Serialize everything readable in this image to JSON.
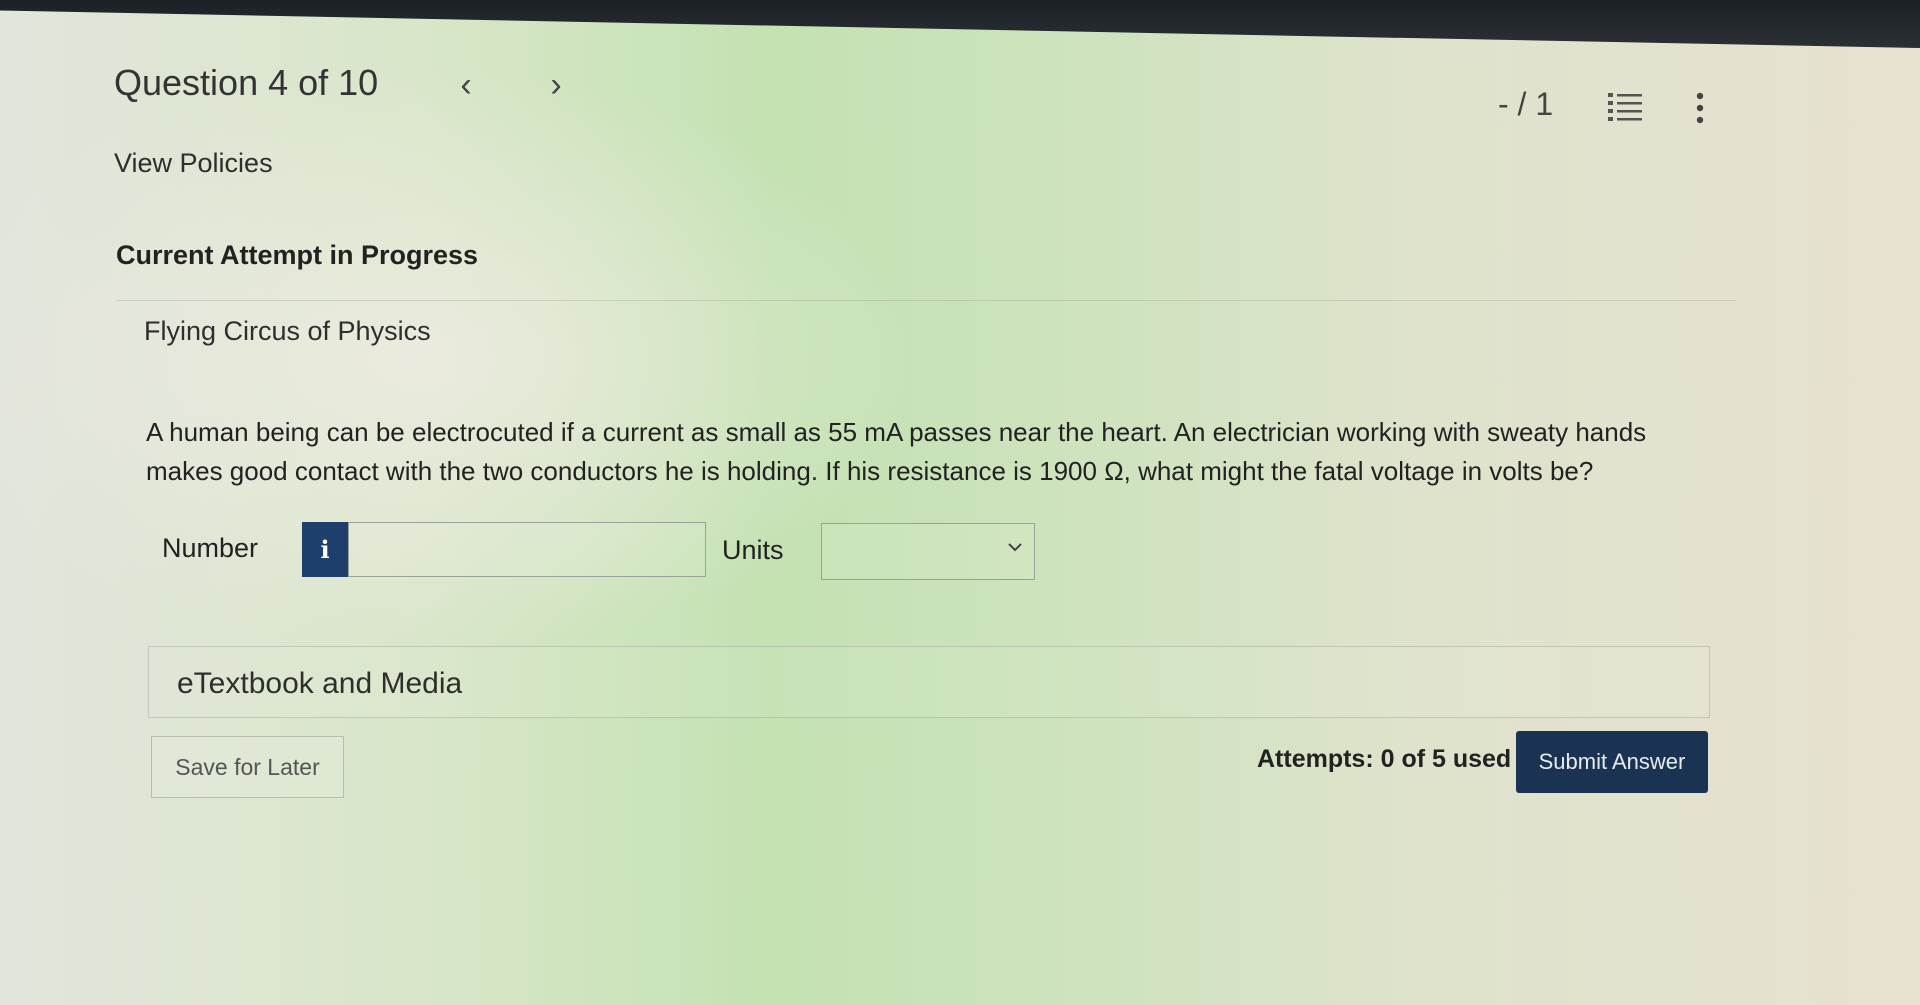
{
  "header": {
    "title": "Question 4 of 10",
    "prev_arrow": "‹",
    "next_arrow": "›",
    "score": "- / 1",
    "list_icon": "list-icon",
    "more_icon": "more-vertical-icon"
  },
  "links": {
    "view_policies": "View Policies"
  },
  "attempt": {
    "heading": "Current Attempt in Progress"
  },
  "question": {
    "source": "Flying Circus of Physics",
    "text": "A human being can be electrocuted if a current as small as 55 mA passes near the heart. An electrician working with sweaty hands makes good contact with the two conductors he is holding. If his resistance is 1900 Ω, what might the fatal voltage in volts be?"
  },
  "answer": {
    "number_label": "Number",
    "info_button": "i",
    "number_value": "",
    "units_label": "Units",
    "units_selected": ""
  },
  "resources": {
    "etextbook_label": "eTextbook and Media"
  },
  "footer": {
    "save_label": "Save for Later",
    "attempts_text": "Attempts: 0 of 5 used",
    "submit_label": "Submit Answer"
  },
  "colors": {
    "info_button_bg": "#1e3f6c",
    "submit_bg": "#1b3352"
  }
}
